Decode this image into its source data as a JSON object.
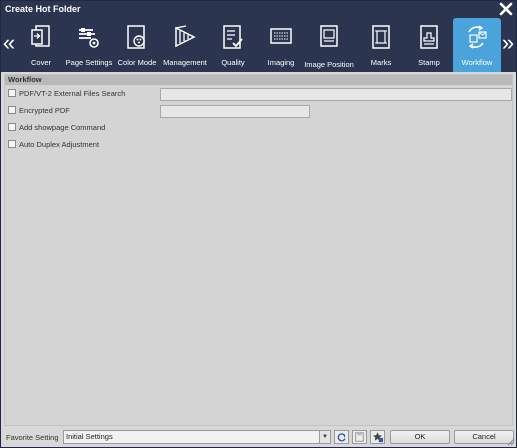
{
  "window": {
    "title": "Create Hot Folder"
  },
  "tabs": [
    {
      "label": "Cover",
      "icon": "cover-icon"
    },
    {
      "label": "Page Settings",
      "icon": "page-settings-icon"
    },
    {
      "label": "Color Mode",
      "icon": "color-mode-icon"
    },
    {
      "label": "Management",
      "icon": "management-icon"
    },
    {
      "label": "Quality",
      "icon": "quality-icon"
    },
    {
      "label": "Imaging",
      "icon": "imaging-icon"
    },
    {
      "label": "Image Position",
      "icon": "image-position-icon"
    },
    {
      "label": "Marks",
      "icon": "marks-icon"
    },
    {
      "label": "Stamp",
      "icon": "stamp-icon"
    },
    {
      "label": "Workflow",
      "icon": "workflow-icon",
      "active": true
    }
  ],
  "section": {
    "title": "Workflow"
  },
  "options": {
    "pdf_vt2": {
      "label": "PDF/VT-2 External Files Search",
      "checked": false,
      "value": ""
    },
    "encrypted_pdf": {
      "label": "Encrypted PDF",
      "checked": false,
      "value": ""
    },
    "showpage": {
      "label": "Add showpage Command",
      "checked": false
    },
    "auto_duplex": {
      "label": "Auto Duplex Adjustment",
      "checked": false
    }
  },
  "footer": {
    "favorite_label": "Favorite Setting",
    "favorite_value": "Initial Settings",
    "ok_label": "OK",
    "cancel_label": "Cancel"
  },
  "colors": {
    "titlebar": "#2b3550",
    "active_tab": "#4aa3da",
    "panel": "#d4d4d4",
    "section_header": "#b9b9b9"
  }
}
